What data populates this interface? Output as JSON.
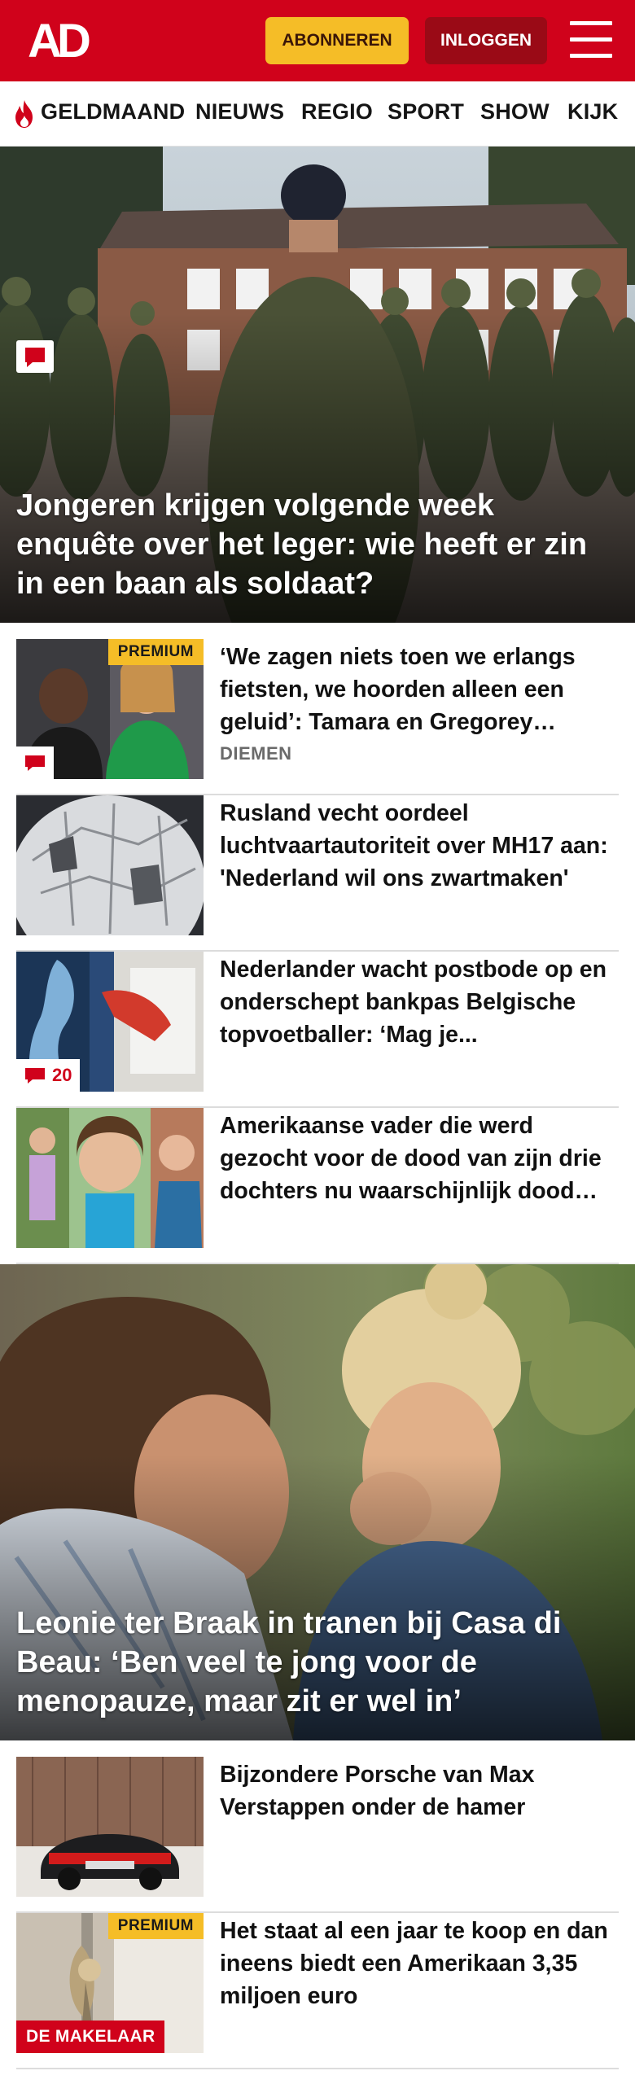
{
  "header": {
    "logo_text": "AD",
    "subscribe_label": "ABONNEREN",
    "login_label": "INLOGGEN",
    "menu_icon": "hamburger-menu-icon",
    "brand_color": "#d0021b",
    "subscribe_color": "#f5bd27"
  },
  "nav": {
    "items": [
      {
        "label": "GELDMAAND",
        "icon": "flame-icon"
      },
      {
        "label": "NIEUWS"
      },
      {
        "label": "REGIO"
      },
      {
        "label": "SPORT"
      },
      {
        "label": "SHOW"
      },
      {
        "label": "KIJK"
      }
    ]
  },
  "articles": {
    "hero1": {
      "title": "Jongeren krijgen volgende week enquête over het leger: wie heeft er zin in een baan als soldaat?",
      "icon": "comment-icon"
    },
    "list1": [
      {
        "title": "‘We zagen niets toen we erlangs fietsten, we hoorden alleen een geluid’: Tamara en Gregorey ontdekten...",
        "badge": "PREMIUM",
        "meta": "DIEMEN",
        "icon": "comment-icon"
      },
      {
        "title": "Rusland vecht oordeel luchtvaartautoriteit over MH17 aan: 'Nederland wil ons zwartmaken'"
      },
      {
        "title": "Nederlander wacht postbode op en onderschept bankpas Belgische topvoetballer: ‘Mag je...",
        "comment_count": "20",
        "icon": "comment-icon"
      },
      {
        "title": "Amerikaanse vader die werd gezocht voor de dood van zijn drie dochters nu waarschijnlijk dood gevonden"
      }
    ],
    "hero2": {
      "title": "Leonie ter Braak in tranen bij Casa di Beau: ‘Ben veel te jong voor de menopauze, maar zit er wel in’"
    },
    "list2": [
      {
        "title": "Bijzondere Porsche van Max Verstappen onder de hamer"
      },
      {
        "title": "Het staat al een jaar te koop en dan ineens biedt een Amerikaan 3,35 miljoen euro",
        "badge": "PREMIUM",
        "label": "DE MAKELAAR"
      }
    ]
  }
}
